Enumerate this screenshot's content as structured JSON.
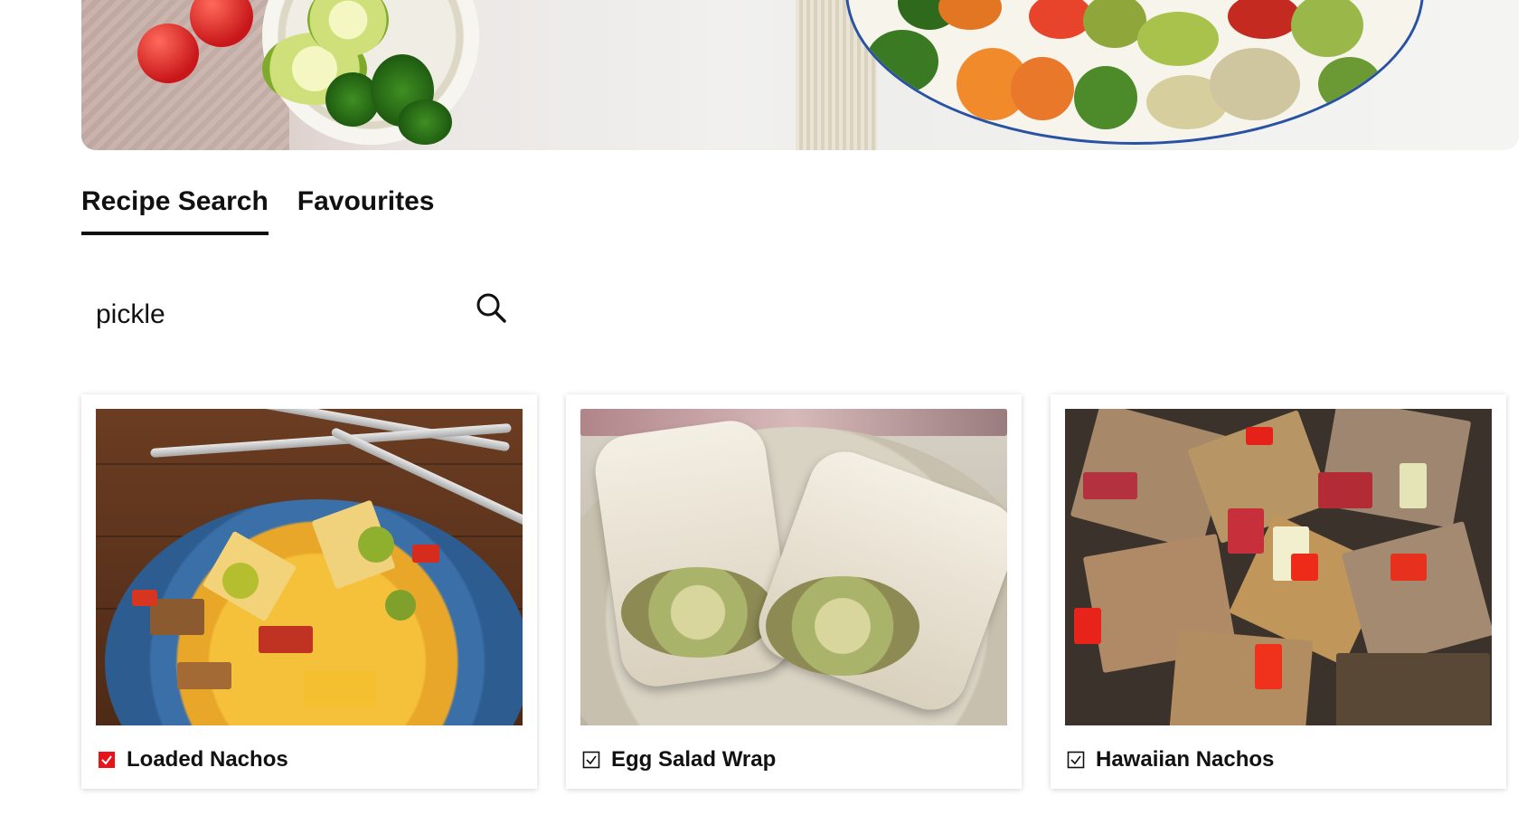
{
  "tabs": [
    {
      "label": "Recipe Search",
      "active": true
    },
    {
      "label": "Favourites",
      "active": false
    }
  ],
  "search": {
    "value": "pickle",
    "icon": "search-icon"
  },
  "recipes": [
    {
      "title": "Loaded Nachos",
      "favourite": true,
      "image": "loaded-nachos-photo"
    },
    {
      "title": "Egg Salad Wrap",
      "favourite": false,
      "image": "egg-salad-wrap-photo"
    },
    {
      "title": "Hawaiian Nachos",
      "favourite": false,
      "image": "hawaiian-nachos-photo"
    }
  ],
  "colors": {
    "accent": "#111111",
    "favourite_checked": "#e8121b",
    "card_shadow": "rgba(0,0,0,0.18)"
  }
}
